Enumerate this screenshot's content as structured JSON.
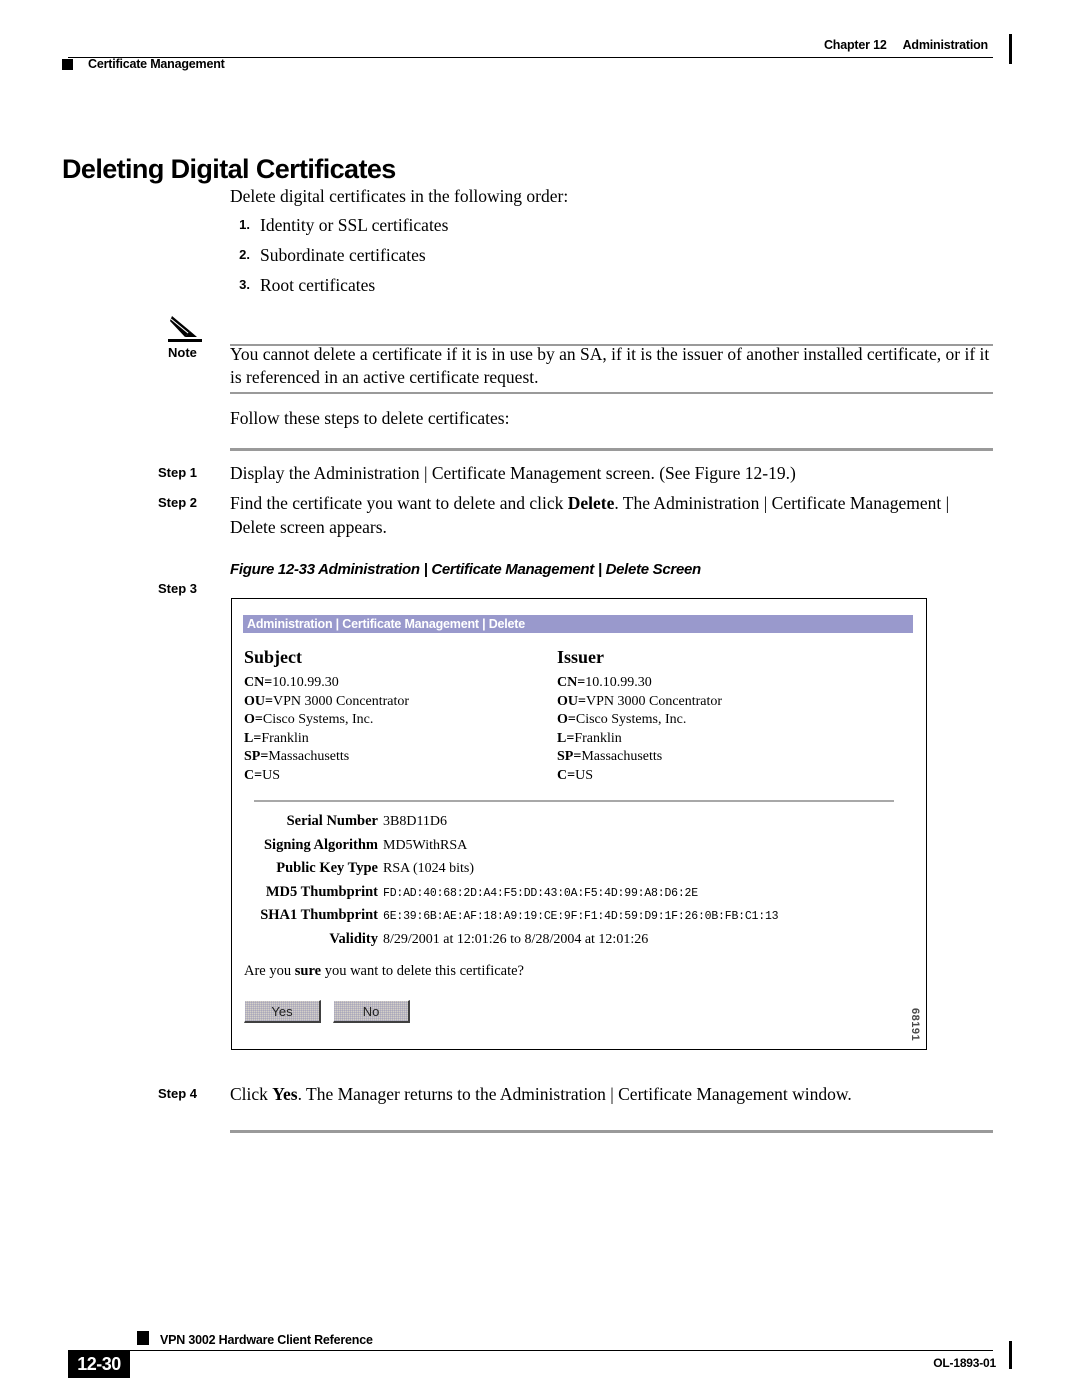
{
  "header": {
    "chapter": "Chapter 12",
    "chapter_title": "Administration",
    "section": "Certificate Management"
  },
  "page_title": "Deleting Digital Certificates",
  "intro": "Delete digital certificates in the following order:",
  "ordered_list": [
    {
      "num": "1.",
      "text": "Identity or SSL certificates"
    },
    {
      "num": "2.",
      "text": "Subordinate certificates"
    },
    {
      "num": "3.",
      "text": "Root certificates"
    }
  ],
  "note": {
    "label": "Note",
    "icon": "pencil-icon",
    "text": "You cannot delete a certificate if it is in use by an SA, if it is the issuer of another installed certificate, or if it is referenced in an active certificate request."
  },
  "follow_text": "Follow these steps to delete certificates:",
  "steps": [
    {
      "label": "Step 1",
      "text": "Display the Administration | Certificate Management screen. (See Figure 12-19.)"
    },
    {
      "label": "Step 2",
      "text_before": "Find the certificate you want to delete and click ",
      "bold": "Delete",
      "text_after": ". The Administration | Certificate Management | Delete screen appears."
    },
    {
      "label": "Step 3",
      "text": ""
    },
    {
      "label": "Step 4",
      "text_before": "Click ",
      "bold": "Yes",
      "text_after": ". The Manager returns to the Administration | Certificate Management window."
    }
  ],
  "figure": {
    "caption": "Figure 12-33 Administration | Certificate Management | Delete Screen",
    "figure_number": "68191",
    "titlebar": "Administration | Certificate Management | Delete",
    "titlebar_color": "#9999cc",
    "subject": {
      "heading": "Subject",
      "lines": [
        {
          "key": "CN=",
          "value": "10.10.99.30"
        },
        {
          "key": "OU=",
          "value": "VPN 3000 Concentrator"
        },
        {
          "key": "O=",
          "value": "Cisco Systems, Inc."
        },
        {
          "key": "L=",
          "value": "Franklin"
        },
        {
          "key": "SP=",
          "value": "Massachusetts"
        },
        {
          "key": "C=",
          "value": "US"
        }
      ]
    },
    "issuer": {
      "heading": "Issuer",
      "lines": [
        {
          "key": "CN=",
          "value": "10.10.99.30"
        },
        {
          "key": "OU=",
          "value": "VPN 3000 Concentrator"
        },
        {
          "key": "O=",
          "value": "Cisco Systems, Inc."
        },
        {
          "key": "L=",
          "value": "Franklin"
        },
        {
          "key": "SP=",
          "value": "Massachusetts"
        },
        {
          "key": "C=",
          "value": "US"
        }
      ]
    },
    "details": [
      {
        "key": "Serial Number",
        "value": "3B8D11D6",
        "mono": false
      },
      {
        "key": "Signing Algorithm",
        "value": "MD5WithRSA",
        "mono": false
      },
      {
        "key": "Public Key Type",
        "value": "RSA (1024 bits)",
        "mono": false
      },
      {
        "key": "MD5 Thumbprint",
        "value": "FD:AD:40:68:2D:A4:F5:DD:43:0A:F5:4D:99:A8:D6:2E",
        "mono": true
      },
      {
        "key": "SHA1 Thumbprint",
        "value": "6E:39:6B:AE:AF:18:A9:19:CE:9F:F1:4D:59:D9:1F:26:0B:FB:C1:13",
        "mono": true
      },
      {
        "key": "Validity",
        "value": "8/29/2001 at 12:01:26 to 8/28/2004 at 12:01:26",
        "mono": false
      }
    ],
    "confirm_before": "Are you ",
    "confirm_bold": "sure",
    "confirm_after": " you want to delete this certificate?",
    "buttons": [
      {
        "label": "Yes"
      },
      {
        "label": "No"
      }
    ]
  },
  "footer": {
    "doc_title": "VPN 3002 Hardware Client Reference",
    "page_number": "12-30",
    "doc_id": "OL-1893-01"
  }
}
